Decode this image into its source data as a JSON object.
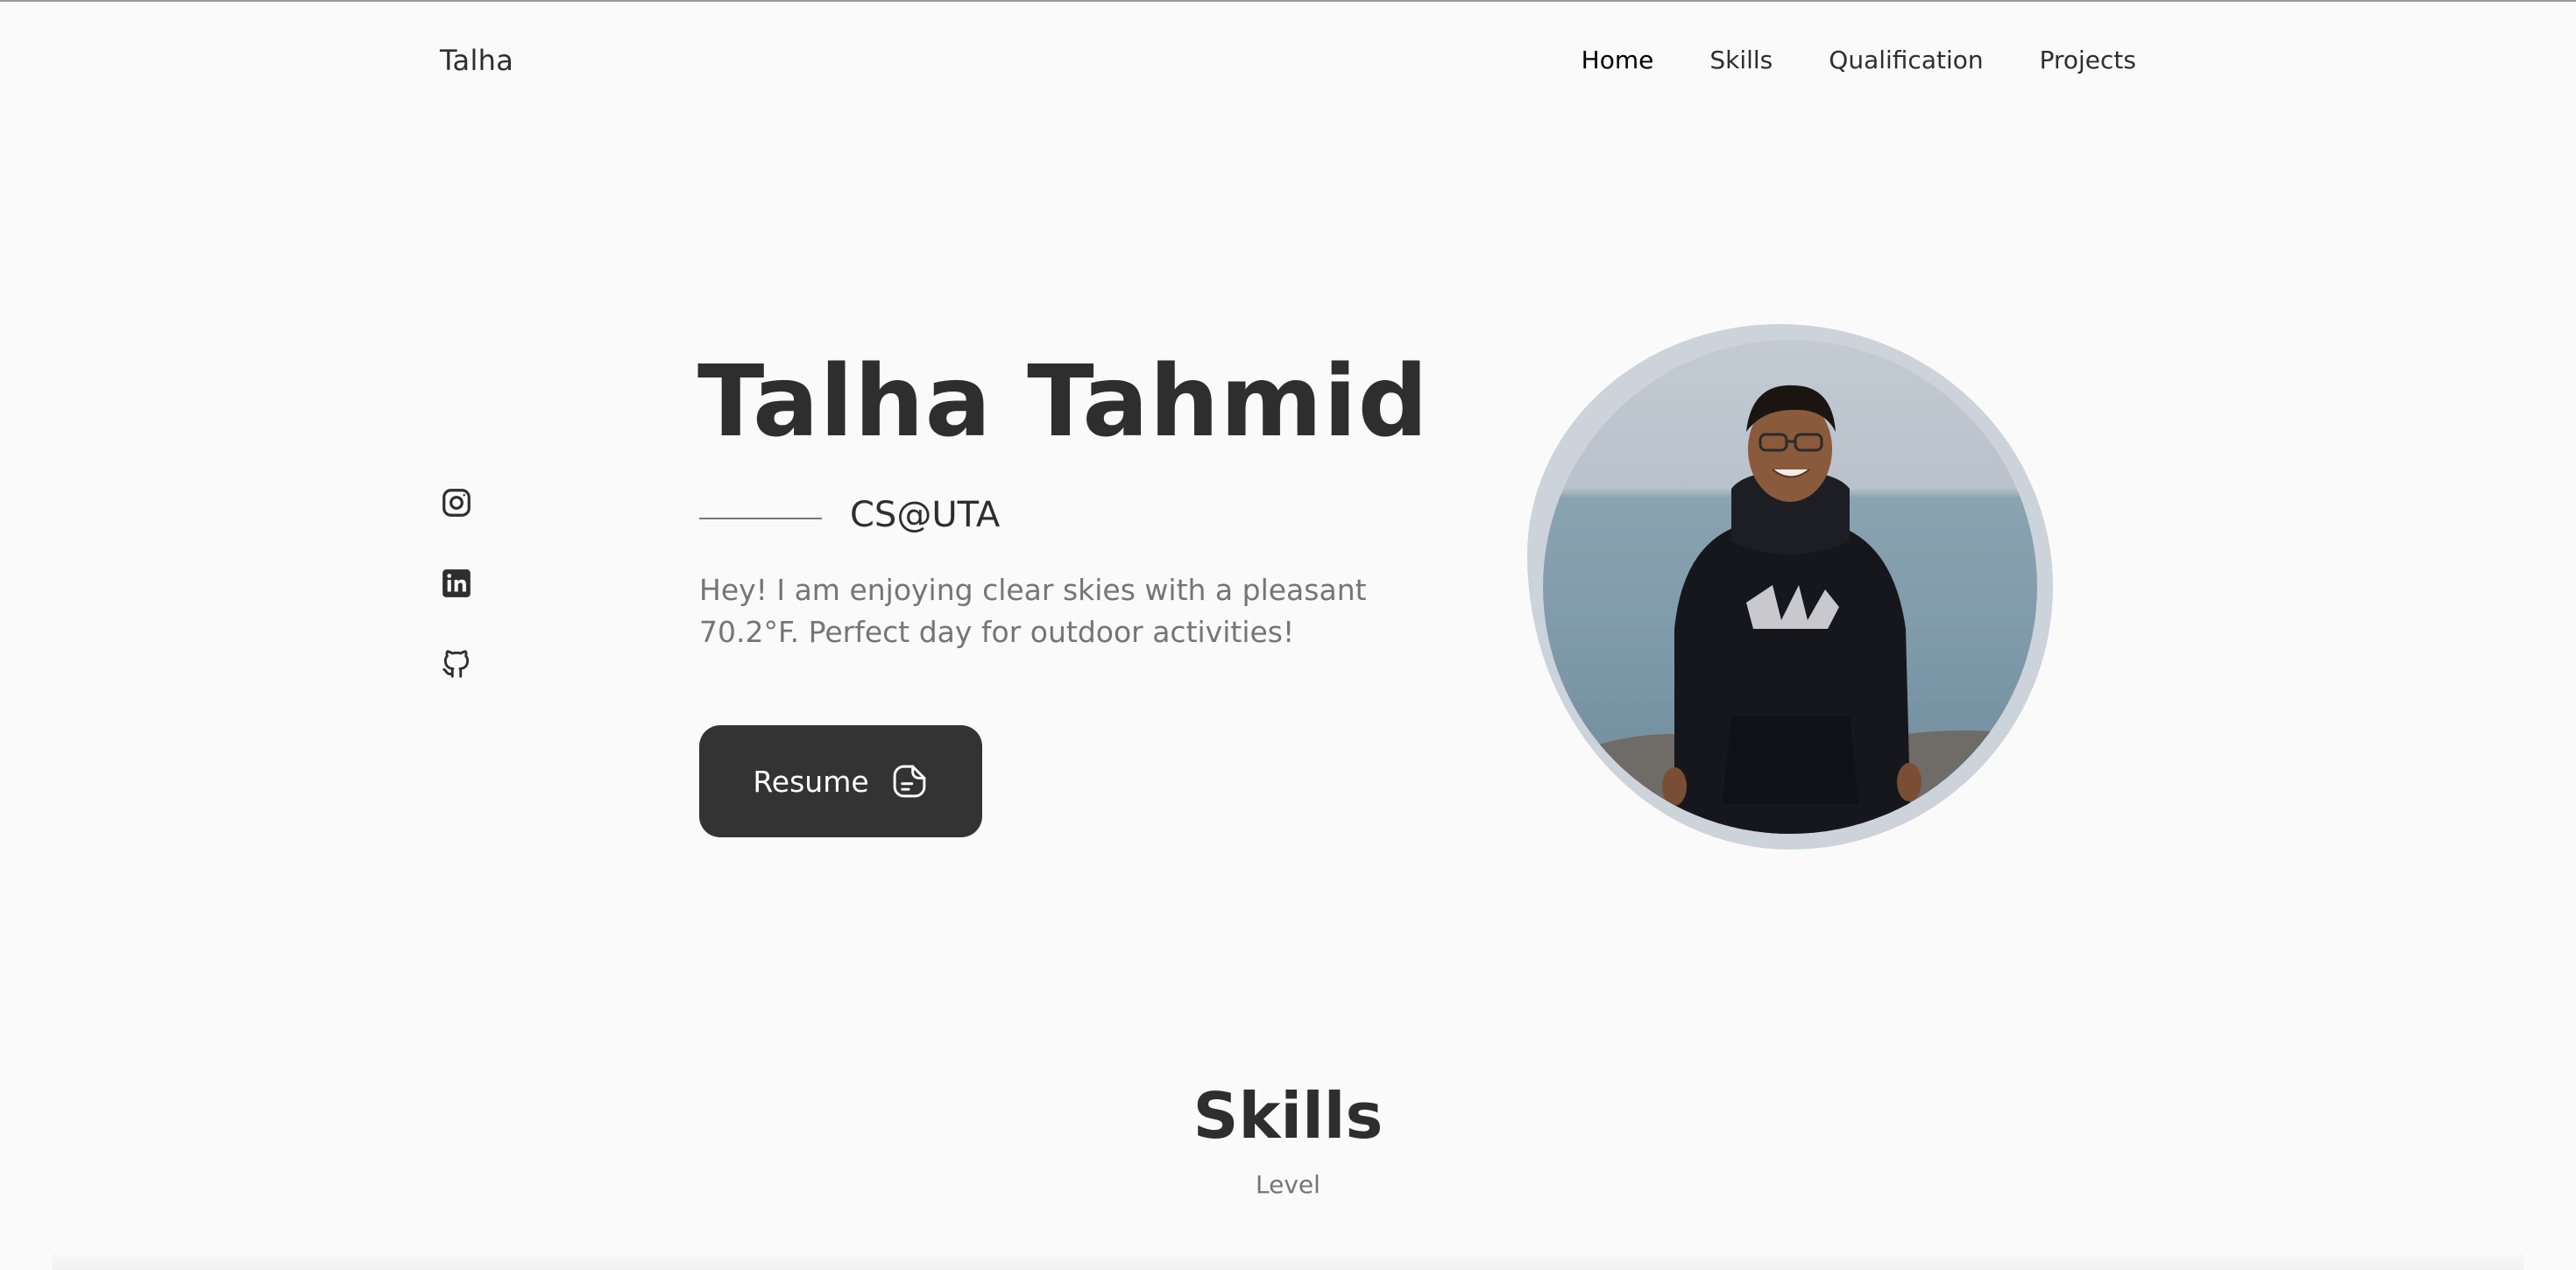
{
  "header": {
    "logo": "Talha",
    "nav": [
      {
        "label": "Home",
        "active": true
      },
      {
        "label": "Skills",
        "active": false
      },
      {
        "label": "Qualification",
        "active": false
      },
      {
        "label": "Projects",
        "active": false
      }
    ]
  },
  "social": {
    "icons": [
      "instagram-icon",
      "linkedin-icon",
      "github-icon"
    ]
  },
  "hero": {
    "name": "Talha Tahmid",
    "subtitle": "CS@UTA",
    "description": "Hey! I am enjoying clear skies with a pleasant 70.2°F. Perfect day for outdoor activities!",
    "resume_label": "Resume"
  },
  "skills": {
    "title": "Skills",
    "subtitle": "Level"
  },
  "colors": {
    "background": "#fafafa",
    "text": "#2e2e2e",
    "muted": "#757575",
    "button": "#333333"
  }
}
